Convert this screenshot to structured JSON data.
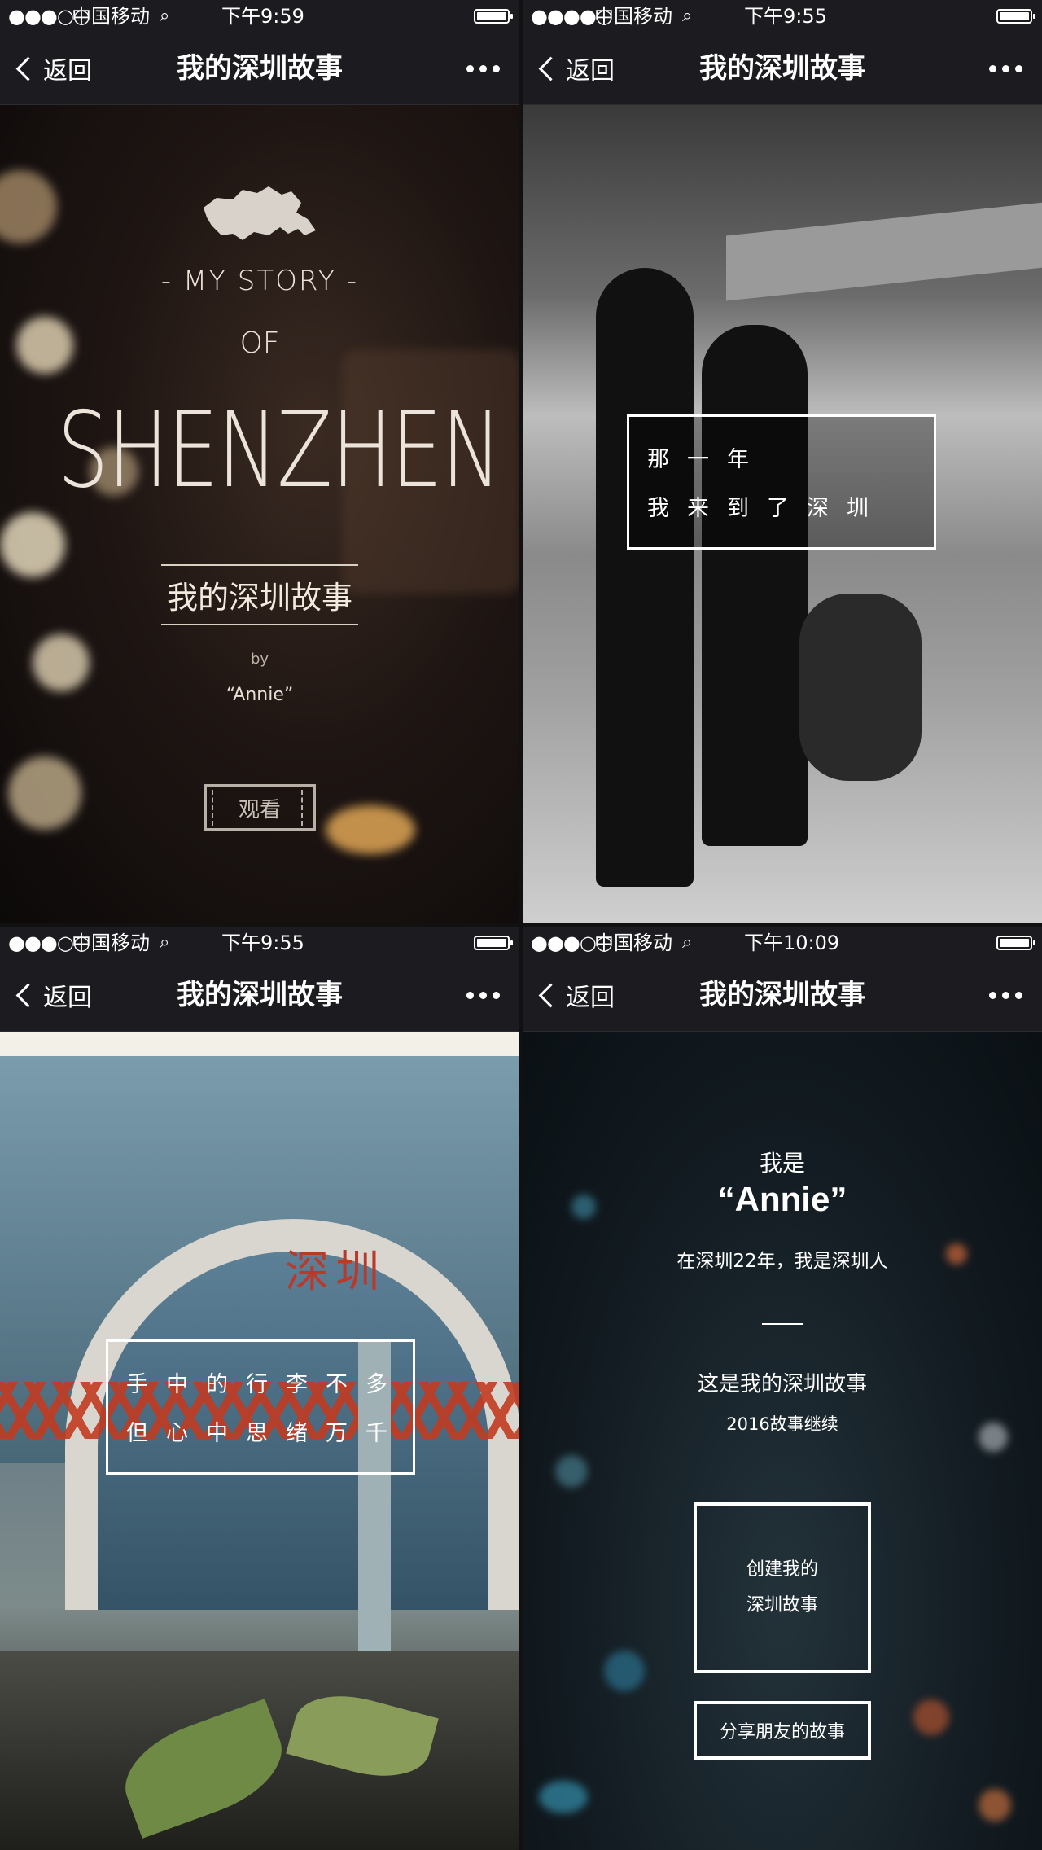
{
  "screens": [
    {
      "status": {
        "signal": "●●●○○",
        "carrier": "中国移动",
        "wifi": "wifi-icon",
        "time": "下午9:59"
      },
      "nav": {
        "back": "返回",
        "title": "我的深圳故事"
      },
      "cover": {
        "line1": "- MY STORY -",
        "line2": "OF",
        "city": "SHENZHEN",
        "title_cn": "我的深圳故事",
        "by": "by",
        "author": "“Annie”",
        "watch": "观看"
      }
    },
    {
      "status": {
        "signal": "●●●●○",
        "carrier": "中国移动",
        "wifi": "wifi-icon",
        "time": "下午9:55"
      },
      "nav": {
        "back": "返回",
        "title": "我的深圳故事"
      },
      "caption": {
        "line1": "那一年",
        "line2": "我来到了深圳"
      }
    },
    {
      "status": {
        "signal": "●●●○○",
        "carrier": "中国移动",
        "wifi": "wifi-icon",
        "time": "下午9:55"
      },
      "nav": {
        "back": "返回",
        "title": "我的深圳故事"
      },
      "photo_sign": "深圳",
      "caption": {
        "line1": "手中的行李不多",
        "line2": "但心中思绪万千"
      }
    },
    {
      "status": {
        "signal": "●●●○○",
        "carrier": "中国移动",
        "wifi": "wifi-icon",
        "time": "下午10:09"
      },
      "nav": {
        "back": "返回",
        "title": "我的深圳故事"
      },
      "ending": {
        "intro": "我是",
        "author": "“Annie”",
        "years": "在深圳22年，我是深圳人",
        "story": "这是我的深圳故事",
        "continue": "2016故事继续",
        "create_line1": "创建我的",
        "create_line2": "深圳故事",
        "share": "分享朋友的故事"
      }
    }
  ],
  "colors": {
    "bar_bg": "#1c1b20",
    "text": "#ffffff",
    "cover_text": "#ece4da"
  }
}
